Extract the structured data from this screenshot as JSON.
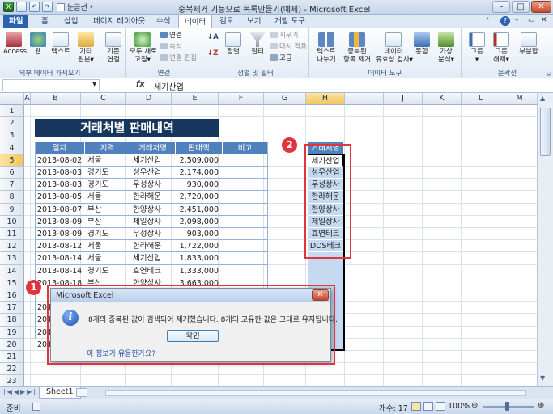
{
  "window": {
    "title": "중복제거 기능으로 목록만들기(예제) - Microsoft Excel",
    "minimize": "–",
    "restore": "□",
    "close": "✕"
  },
  "qat": {
    "save": "💾",
    "undo": "↶",
    "redo": "↷",
    "extra": "눈금선"
  },
  "tabs": [
    "파일",
    "홈",
    "삽입",
    "페이지 레이아웃",
    "수식",
    "데이터",
    "검토",
    "보기",
    "개발 도구"
  ],
  "active_tab": "데이터",
  "ribbon": {
    "external": {
      "group": "외부 데이터 가져오기",
      "items": [
        "Access",
        "웹",
        "텍스트",
        "기타\n원본▾",
        "기존\n연결"
      ]
    },
    "connections": {
      "group": "연결",
      "refresh": "모두 새로\n고침▾",
      "small": [
        "연결",
        "속성",
        "연결 편집"
      ]
    },
    "sortfilter": {
      "group": "정렬 및 필터",
      "sort": "정렬",
      "filter": "필터",
      "small": [
        "지우기",
        "다시 적용",
        "고급"
      ]
    },
    "datatools": {
      "group": "데이터 도구",
      "items": [
        "텍스트\n나누기",
        "중복된\n항목 제거",
        "데이터\n유효성 검사▾",
        "통합",
        "가상\n분석▾"
      ]
    },
    "outline": {
      "group": "윤곽선",
      "items": [
        "그룹\n▾",
        "그룹\n해제▾",
        "부분합"
      ]
    }
  },
  "formula_bar": {
    "namebox": "",
    "fx": "fx",
    "value": "세기산업"
  },
  "columns": [
    "A",
    "B",
    "C",
    "D",
    "E",
    "F",
    "G",
    "H",
    "I",
    "J",
    "K",
    "L",
    "M"
  ],
  "rows": [
    "1",
    "2",
    "3",
    "4",
    "5",
    "6",
    "7",
    "8",
    "9",
    "10",
    "11",
    "12",
    "13",
    "14",
    "15",
    "16",
    "17",
    "18",
    "19",
    "20",
    "21",
    "22",
    "23"
  ],
  "banner": "거래처별 판매내역",
  "table_headers": [
    "일자",
    "지역",
    "거래처명",
    "판매액",
    "비고"
  ],
  "table_rows": [
    [
      "2013-08-02",
      "서울",
      "세기산업",
      "2,509,000"
    ],
    [
      "2013-08-03",
      "경기도",
      "성우산업",
      "2,174,000"
    ],
    [
      "2013-08-03",
      "경기도",
      "우성상사",
      "930,000"
    ],
    [
      "2013-08-05",
      "서울",
      "한라해운",
      "2,720,000"
    ],
    [
      "2013-08-07",
      "부산",
      "한양상사",
      "2,451,000"
    ],
    [
      "2013-08-09",
      "부산",
      "제일상사",
      "2,098,000"
    ],
    [
      "2013-08-09",
      "경기도",
      "우성상사",
      "903,000"
    ],
    [
      "2013-08-12",
      "서울",
      "한라해운",
      "1,722,000"
    ],
    [
      "2013-08-14",
      "서울",
      "세기산업",
      "1,833,000"
    ],
    [
      "2013-08-14",
      "경기도",
      "효연테크",
      "1,333,000"
    ],
    [
      "2013-08-18",
      "부산",
      "한양상사",
      "3,663,000"
    ]
  ],
  "partial_dates": [
    "2013",
    "2013",
    "2013",
    "2013"
  ],
  "list_header": "거래처명",
  "list_values": [
    "세기산업",
    "성우산업",
    "우성상사",
    "한라해운",
    "한양상사",
    "제일상사",
    "효연테크",
    "DDS테크"
  ],
  "badges": [
    "1",
    "2"
  ],
  "dialog": {
    "title": "Microsoft Excel",
    "message": "8개의 중복된 값이 검색되어 제거했습니다. 8개의 고유한 값은 그대로 유지됩니다.",
    "ok": "확인",
    "help": "이 정보가 유용한가요?",
    "close": "✕",
    "icon": "i"
  },
  "sheet_tabs": [
    "Sheet1"
  ],
  "status": {
    "mode": "준비",
    "count": "개수: 17",
    "zoom": "100%"
  },
  "colors": {
    "accent": "#4f81bd",
    "banner": "#17365d",
    "highlight": "#e0353d",
    "list_fill": "#c5d9f1"
  }
}
